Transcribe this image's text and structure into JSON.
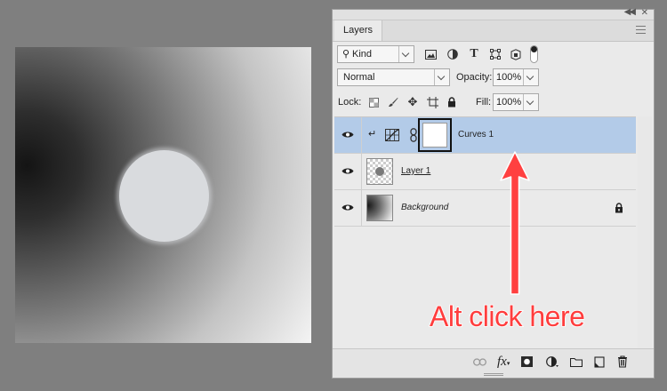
{
  "panel": {
    "tab_label": "Layers",
    "filter": {
      "value": "Kind"
    },
    "blend_mode": {
      "value": "Normal"
    },
    "opacity": {
      "label": "Opacity:",
      "value": "100%"
    },
    "lock": {
      "label": "Lock:"
    },
    "fill": {
      "label": "Fill:",
      "value": "100%"
    },
    "layers": [
      {
        "name": "Curves 1",
        "kind": "adjustment",
        "selected": true
      },
      {
        "name": "Layer 1",
        "kind": "pixel",
        "selected": false
      },
      {
        "name": "Background",
        "kind": "background",
        "selected": false,
        "locked": true
      }
    ]
  },
  "annotation": {
    "text": "Alt click here",
    "color": "#ff3d3d"
  },
  "colors": {
    "selection": "#b3cbe8",
    "panel_bg": "#eaeaea",
    "app_bg": "#7f7f7f"
  }
}
